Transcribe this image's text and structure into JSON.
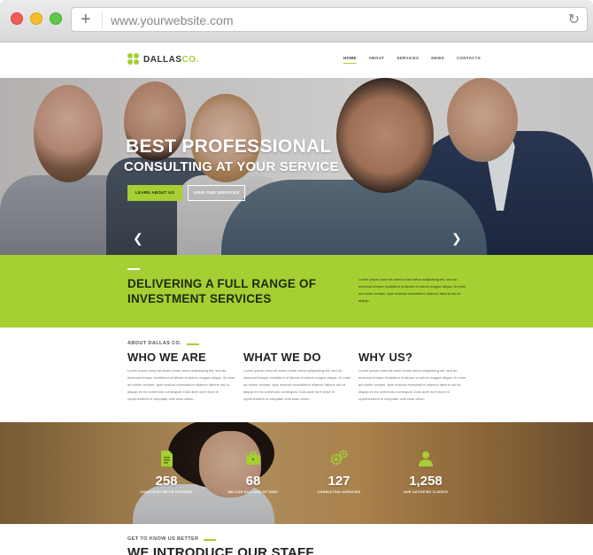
{
  "browser": {
    "url": "www.yourwebsite.com"
  },
  "logo": {
    "name_main": "DALLAS",
    "name_accent": "CO."
  },
  "nav": {
    "items": [
      "HOME",
      "ABOUT",
      "SERVICES",
      "NEWS",
      "CONTACTS"
    ]
  },
  "hero": {
    "title_line1": "BEST PROFESSIONAL",
    "title_line2": "CONSULTING AT YOUR SERVICE",
    "primary_button": "LEARN ABOUT US",
    "secondary_button": "VIEW OUR SERVICES"
  },
  "band": {
    "title_line1": "DELIVERING A FULL RANGE OF",
    "title_line2": "INVESTMENT SERVICES",
    "text": "Lorem ipsum dolor sit amet conse ctetur adipisicing elit, sed do eiusmod tempor incididunt ut labore et dolore magna aliqua. Ut enim ad minim veniam, quis nostrud exercitation ullamco laboris nisi ut aliquip."
  },
  "about": {
    "kicker": "ABOUT DALLAS CO.",
    "columns": [
      {
        "title": "WHO WE ARE",
        "text": "Lorem ipsum dolor sit amet conse ctetur adipisicing elit, sed do eiusmod tempor incididunt ut labore et dolore magna aliqua. Ut enim ad minim veniam, quis nostrud exercitation ullamco laboris nisi ut aliquip ex ea commodo consequat. Duis aute irure dolor in reprehenderit in voluptate velit esse cillum."
      },
      {
        "title": "WHAT WE DO",
        "text": "Lorem ipsum dolor sit amet conse ctetur adipisicing elit, sed do eiusmod tempor incididunt ut labore et dolore magna aliqua. Ut enim ad minim veniam, quis nostrud exercitation ullamco laboris nisi ut aliquip ex ea commodo consequat. Duis aute irure dolor in reprehenderit in voluptate velit esse cillum."
      },
      {
        "title": "WHY US?",
        "text": "Lorem ipsum dolor sit amet conse ctetur adipisicing elit, sed do eiusmod tempor incididunt ut labore et dolore magna aliqua. Ut enim ad minim veniam, quis nostrud exercitation ullamco laboris nisi ut aliquip ex ea commodo consequat. Duis aute irure dolor in reprehenderit in voluptate velit esse cillum."
      }
    ]
  },
  "stats": [
    {
      "icon": "document-icon",
      "value": "258",
      "label": "COUNTRIES WE'VE COVERED"
    },
    {
      "icon": "briefcase-icon",
      "value": "68",
      "label": "MILLION DOLLARS OF DEBT"
    },
    {
      "icon": "gears-icon",
      "value": "127",
      "label": "CONSULTING AGENCIES"
    },
    {
      "icon": "person-icon",
      "value": "1,258",
      "label": "OUR SATISFIED CLIENTS"
    }
  ],
  "team": {
    "kicker": "GET TO KNOW US BETTER",
    "title": "WE INTRODUCE OUR STAFF"
  },
  "colors": {
    "accent": "#a5cf33",
    "dark_text": "#222222"
  }
}
